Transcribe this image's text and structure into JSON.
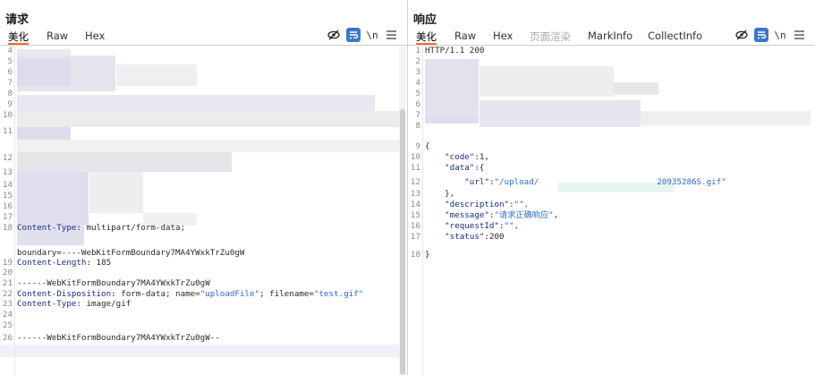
{
  "request": {
    "title": "请求",
    "tabs": [
      {
        "label": "美化",
        "active": true
      },
      {
        "label": "Raw"
      },
      {
        "label": "Hex"
      }
    ],
    "tools": {
      "ln_label": "\\n"
    },
    "lines": [
      {
        "n": "4",
        "text": ""
      },
      {
        "n": "5",
        "text": ""
      },
      {
        "n": "6",
        "text": ""
      },
      {
        "n": "7",
        "text": ""
      },
      {
        "n": "8",
        "text": ""
      },
      {
        "n": "9",
        "text": ""
      },
      {
        "n": "10",
        "text": ""
      },
      {
        "n": "11",
        "text": ""
      },
      {
        "n": "12",
        "text": ""
      },
      {
        "n": "13",
        "text": ""
      },
      {
        "n": "14",
        "text": ""
      },
      {
        "n": "15",
        "text": ""
      },
      {
        "n": "16",
        "text": ""
      },
      {
        "n": "17",
        "text": ""
      },
      {
        "n": "18",
        "key": "Content-Type",
        "value": " multipart/form-data;"
      },
      {
        "n": "",
        "value": "boundary=----WebKitFormBoundary7MA4YWxkTrZu0gW"
      },
      {
        "n": "19",
        "key": "Content-Length",
        "value": " 185"
      },
      {
        "n": "20",
        "text": ""
      },
      {
        "n": "21",
        "value": "------WebKitFormBoundary7MA4YWxkTrZu0gW"
      },
      {
        "n": "22",
        "key": "Content-Disposition",
        "value": " form-data; name=",
        "s1": "\"uploadFile\"",
        "v2": "; filename=",
        "s2": "\"test.gif\""
      },
      {
        "n": "23",
        "key": "Content-Type",
        "value": " image/gif"
      },
      {
        "n": "24",
        "text": ""
      },
      {
        "n": "25",
        "text": ""
      },
      {
        "n": "26",
        "value": "------WebKitFormBoundary7MA4YWxkTrZu0gW--"
      }
    ]
  },
  "response": {
    "title": "响应",
    "tabs": [
      {
        "label": "美化",
        "active": true
      },
      {
        "label": "Raw"
      },
      {
        "label": "Hex"
      },
      {
        "label": "页面渲染",
        "disabled": true
      },
      {
        "label": "MarkInfo"
      },
      {
        "label": "CollectInfo"
      }
    ],
    "tools": {
      "ln_label": "\\n"
    },
    "lines": [
      {
        "n": "1",
        "value": "HTTP/1.1 200"
      },
      {
        "n": "2",
        "text": ""
      },
      {
        "n": "3",
        "text": ""
      },
      {
        "n": "4",
        "text": ""
      },
      {
        "n": "5",
        "text": ""
      },
      {
        "n": "6",
        "text": ""
      },
      {
        "n": "7",
        "text": ""
      },
      {
        "n": "8",
        "text": ""
      },
      {
        "n": "9",
        "value": "{"
      },
      {
        "n": "10",
        "indent": "    ",
        "s1": "\"code\"",
        "value": ":1,"
      },
      {
        "n": "11",
        "indent": "    ",
        "s1": "\"data\"",
        "value": ":{"
      },
      {
        "n": "12",
        "indent": "        ",
        "s1": "\"url\"",
        "value": ":",
        "s2": "\"/upload/",
        "s3": "20935286S.gif\""
      },
      {
        "n": "13",
        "indent": "    ",
        "value": "},"
      },
      {
        "n": "14",
        "indent": "    ",
        "s1": "\"description\"",
        "value": ":",
        "s2": "\"\","
      },
      {
        "n": "15",
        "indent": "    ",
        "s1": "\"message\"",
        "value": ":",
        "s2": "\"请求正确响应\"",
        "v2": ","
      },
      {
        "n": "16",
        "indent": "    ",
        "s1": "\"requestId\"",
        "value": ":",
        "s2": "\"\","
      },
      {
        "n": "17",
        "indent": "    ",
        "s1": "\"status\"",
        "value": ":200"
      },
      {
        "n": "18",
        "value": "}"
      }
    ]
  }
}
